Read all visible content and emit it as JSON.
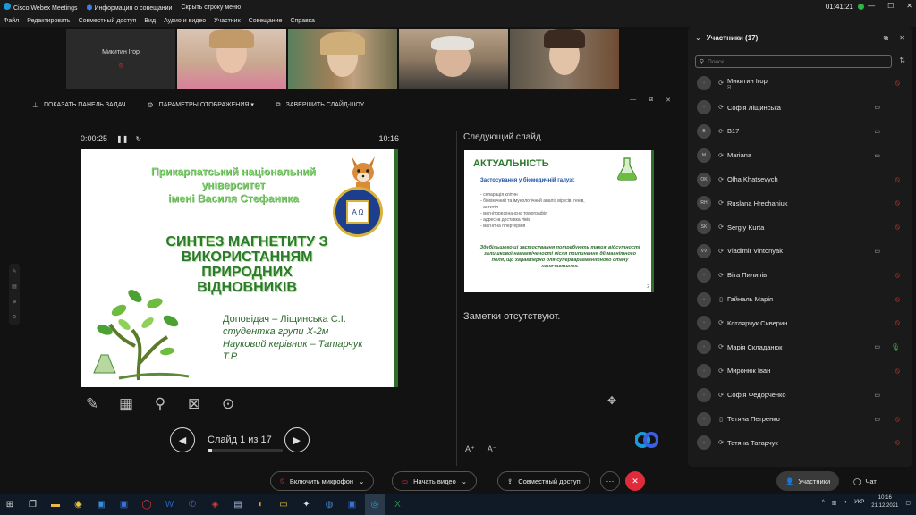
{
  "titlebar": {
    "app_title": "Cisco Webex Meetings",
    "meeting_info": "Информация о совещании",
    "hide_menu": "Скрыть строку меню",
    "clock": "01:41:21"
  },
  "menubar": [
    "Файл",
    "Редактировать",
    "Совместный доступ",
    "Вид",
    "Аудио и видео",
    "Участник",
    "Совещание",
    "Справка"
  ],
  "video_strip": {
    "name_tile": "Микитин Ігор"
  },
  "share_toolbar": {
    "show_taskbar": "ПОКАЗАТЬ ПАНЕЛЬ ЗАДАЧ",
    "display_params": "ПАРАМЕТРЫ ОТОБРАЖЕНИЯ ▾",
    "end_slideshow": "ЗАВЕРШИТЬ СЛАЙД-ШОУ"
  },
  "presenter": {
    "elapsed": "0:00:25",
    "clock": "10:16",
    "slide_label": "Слайд 1 из 17",
    "slide_progress_fraction": 0.06
  },
  "slide": {
    "university": [
      "Прикарпатський національний",
      "університет",
      "імені Василя Стефаника"
    ],
    "emblem_text": "Α Ω",
    "title": [
      "СИНТЕЗ МАГНЕТИТУ З",
      "ВИКОРИСТАННЯМ ПРИРОДНИХ",
      "ВІДНОВНИКІВ"
    ],
    "author_lines": [
      "Доповідач – Ліщинська С.І.",
      "студентка групи Х-2м",
      "Науковий керівник – Татарчук",
      "Т.Р."
    ]
  },
  "next_slide": {
    "header": "Следующий слайд",
    "title": "АКТУАЛЬНІСТЬ",
    "subtitle": "Застосування у біомедичній галузі:",
    "bullets": [
      "сепарація клітин",
      "біохімічний та імунологічний аналіз вірусів, генів,",
      "антитіл",
      "магніторезонансна томографія",
      "адресна доставка ліків",
      "магнітна гіпертермія"
    ],
    "paragraph": "Здебільшого ці застосування потребують також відсутності залишкової намагніченості після припинення дії магнітного поля, що характерно для суперпарамагнітного стану наночастинок.",
    "page_number": "2"
  },
  "notes": {
    "text": "Заметки отсутствуют."
  },
  "participants": {
    "title": "Участники (17)",
    "search_placeholder": "Поиск",
    "list": [
      {
        "name": "Микитин Ігор",
        "sub": "Я",
        "initials": "",
        "device": "⟳",
        "video": "",
        "mic": "muted"
      },
      {
        "name": "Софія Ліщинська",
        "sub": "",
        "initials": "",
        "device": "⟳",
        "video": "▭",
        "mic": "none"
      },
      {
        "name": "В17",
        "sub": "",
        "initials": "B",
        "device": "⟳",
        "video": "▭",
        "mic": "none"
      },
      {
        "name": "Mariana",
        "sub": "",
        "initials": "M",
        "device": "⟳",
        "video": "▭",
        "mic": "none"
      },
      {
        "name": "Olha Khatsevych",
        "sub": "",
        "initials": "OK",
        "device": "⟳",
        "video": "",
        "mic": "muted"
      },
      {
        "name": "Ruslana Hrechaniuk",
        "sub": "",
        "initials": "RH",
        "device": "⟳",
        "video": "",
        "mic": "muted"
      },
      {
        "name": "Sergiy Kurta",
        "sub": "",
        "initials": "SK",
        "device": "⟳",
        "video": "",
        "mic": "muted"
      },
      {
        "name": "Vladimir Vintonyak",
        "sub": "",
        "initials": "VV",
        "device": "⟳",
        "video": "▭",
        "mic": "none"
      },
      {
        "name": "Віта Пилипів",
        "sub": "",
        "initials": "",
        "device": "⟳",
        "video": "",
        "mic": "muted"
      },
      {
        "name": "Гайналь Марія",
        "sub": "",
        "initials": "",
        "device": "▯",
        "video": "",
        "mic": "muted"
      },
      {
        "name": "Котлярчук Сиверин",
        "sub": "",
        "initials": "",
        "device": "⟳",
        "video": "",
        "mic": "muted"
      },
      {
        "name": "Марія Складанюк",
        "sub": "",
        "initials": "",
        "device": "⟳",
        "video": "▭",
        "mic": "on"
      },
      {
        "name": "Миронюк Іван",
        "sub": "",
        "initials": "",
        "device": "⟳",
        "video": "",
        "mic": "muted"
      },
      {
        "name": "Софія Федорченко",
        "sub": "",
        "initials": "",
        "device": "⟳",
        "video": "▭",
        "mic": "none"
      },
      {
        "name": "Тетяна Петренко",
        "sub": "",
        "initials": "",
        "device": "▯",
        "video": "▭",
        "mic": "muted"
      },
      {
        "name": "Тетяна Татарчук",
        "sub": "",
        "initials": "",
        "device": "⟳",
        "video": "",
        "mic": "muted"
      }
    ]
  },
  "controls": {
    "unmute": "Включить микрофон",
    "start_video": "Начать видео",
    "share": "Совместный доступ",
    "more": "···",
    "leave": "✕",
    "participants": "Участники",
    "chat": "Чат"
  },
  "taskbar": {
    "lang": "УКР",
    "time": "10:16",
    "date": "21.12.2021"
  },
  "colors": {
    "mic_muted": "#e03a3a",
    "mic_on": "#3fbf57",
    "leave_button": "#e02b3a",
    "slide_green": "#2c7a2c"
  }
}
